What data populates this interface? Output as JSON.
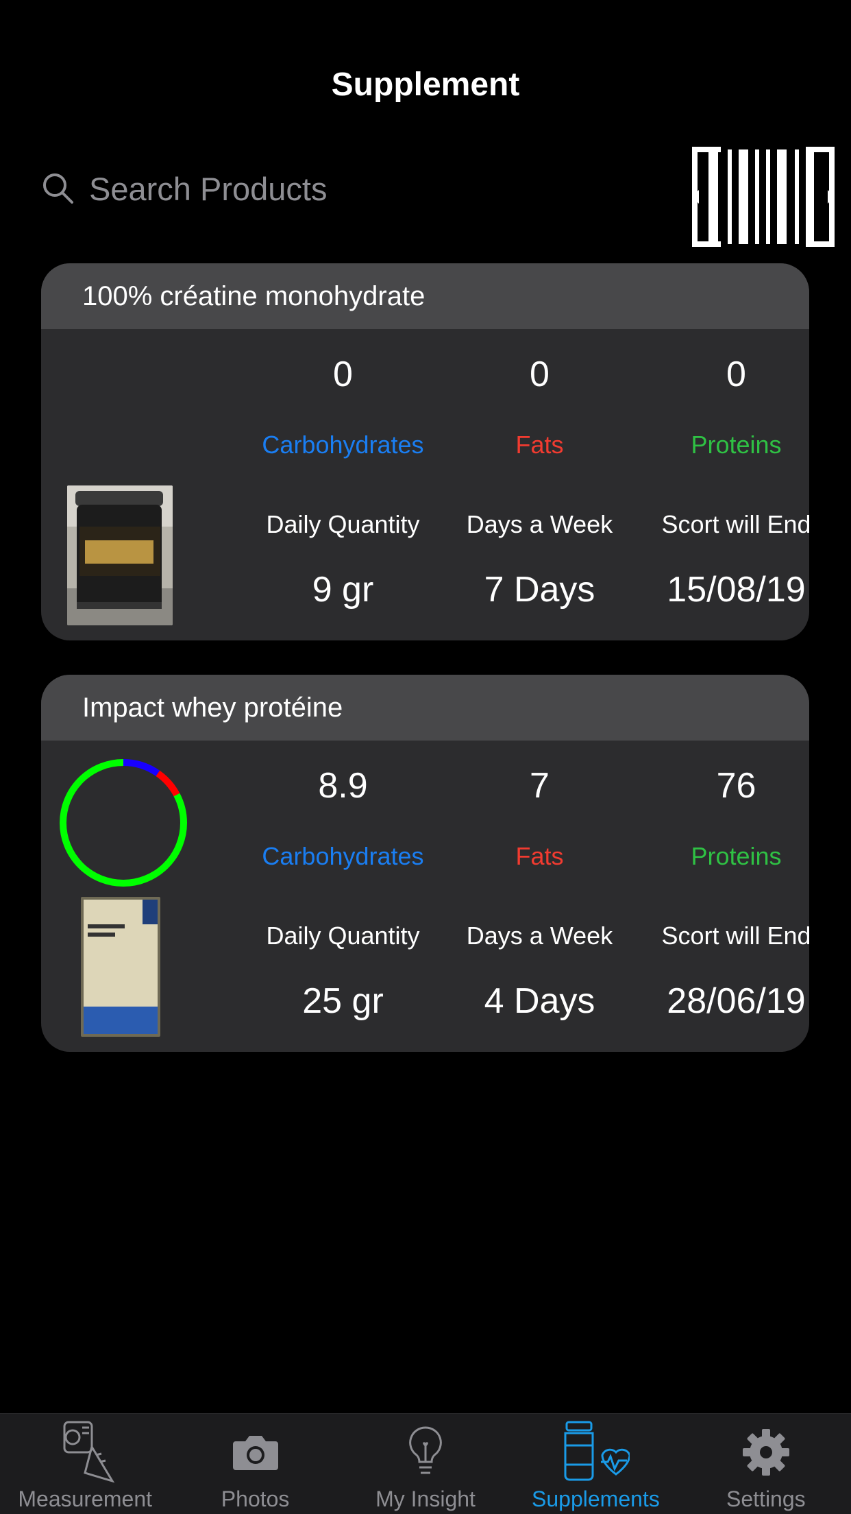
{
  "header": {
    "title": "Supplement"
  },
  "search": {
    "placeholder": "Search Products"
  },
  "colors": {
    "carbs": "#1a7ef2",
    "fats": "#f23b30",
    "proteins": "#2fc144",
    "accent": "#1a9be8"
  },
  "cards": [
    {
      "name": "100% créatine monohydrate",
      "carbs": "0",
      "fats": "0",
      "proteins": "0",
      "carbs_label": "Carbohydrates",
      "fats_label": "Fats",
      "proteins_label": "Proteins",
      "daily_label": "Daily Quantity",
      "days_label": "Days a Week",
      "end_label": "Scort will End",
      "daily": "9 gr",
      "days": "7 Days",
      "end": "15/08/19"
    },
    {
      "name": "Impact whey protéine",
      "carbs": "8.9",
      "fats": "7",
      "proteins": "76",
      "carbs_label": "Carbohydrates",
      "fats_label": "Fats",
      "proteins_label": "Proteins",
      "daily_label": "Daily Quantity",
      "days_label": "Days a Week",
      "end_label": "Scort will End",
      "daily": "25 gr",
      "days": "4 Days",
      "end": "28/06/19",
      "ring": {
        "carbs": 8.9,
        "fats": 7,
        "proteins": 76
      }
    }
  ],
  "tabs": [
    {
      "label": "Measurement",
      "icon": "measuring-tape-icon"
    },
    {
      "label": "Photos",
      "icon": "camera-icon"
    },
    {
      "label": "My Insight",
      "icon": "lightbulb-icon"
    },
    {
      "label": "Supplements",
      "icon": "supplements-icon",
      "active": true
    },
    {
      "label": "Settings",
      "icon": "gear-icon"
    }
  ]
}
